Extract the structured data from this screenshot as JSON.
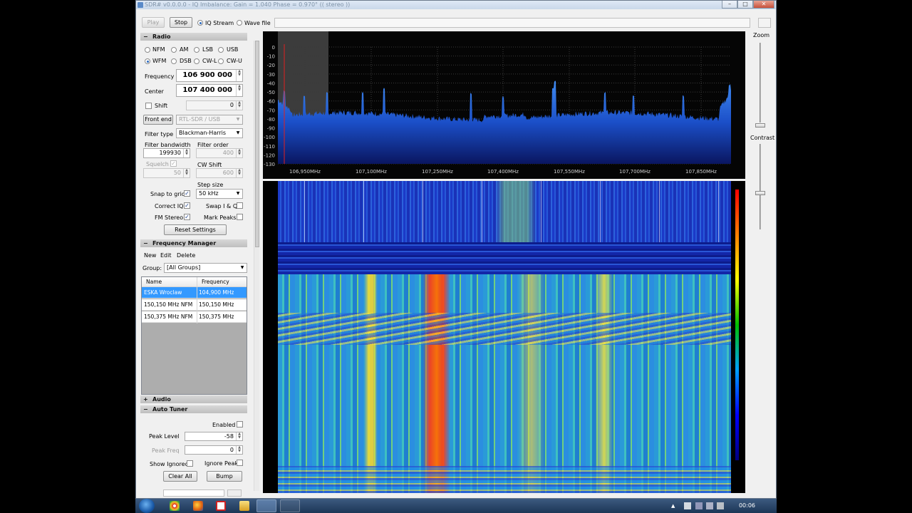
{
  "window": {
    "title": "SDR# v0.0.0.0 - IQ Imbalance: Gain = 1.040 Phase = 0.970° (( stereo ))"
  },
  "overlay_counter": "19",
  "toolbar": {
    "play": "Play",
    "stop": "Stop",
    "iq_stream": "IQ Stream",
    "wave_file": "Wave file"
  },
  "radio": {
    "header": "Radio",
    "modes_row1": [
      "NFM",
      "AM",
      "LSB",
      "USB"
    ],
    "modes_row2": [
      "WFM",
      "DSB",
      "CW-L",
      "CW-U"
    ],
    "selected_mode": "WFM",
    "frequency_label": "Frequency",
    "frequency_value": "106 900 000",
    "center_label": "Center",
    "center_value": "107 400 000",
    "shift_label": "Shift",
    "shift_value": "0",
    "front_end_button": "Front end",
    "front_end_value": "RTL-SDR / USB",
    "filter_type_label": "Filter type",
    "filter_type_value": "Blackman-Harris",
    "filter_bandwidth_label": "Filter bandwidth",
    "filter_bandwidth_value": "199930",
    "filter_order_label": "Filter order",
    "filter_order_value": "400",
    "squelch_label": "Squelch",
    "squelch_value": "50",
    "cw_shift_label": "CW Shift",
    "cw_shift_value": "600",
    "step_size_label": "Step size",
    "step_size_value": "50 kHz",
    "snap_to_grid_label": "Snap to grid",
    "swap_iq_label": "Swap I & Q",
    "correct_iq_label": "Correct IQ",
    "mark_peaks_label": "Mark Peaks",
    "fm_stereo_label": "FM Stereo",
    "reset_settings": "Reset Settings"
  },
  "freq_manager": {
    "header": "Frequency Manager",
    "menu": [
      "New",
      "Edit",
      "Delete"
    ],
    "group_label": "Group:",
    "group_value": "[All Groups]",
    "columns": [
      "Name",
      "Frequency"
    ],
    "rows": [
      {
        "name": "ESKA Wroclaw",
        "freq": "104,900 MHz"
      },
      {
        "name": "150,150 MHz NFM",
        "freq": "150,150 MHz"
      },
      {
        "name": "150,375 MHz NFM",
        "freq": "150,375 MHz"
      }
    ]
  },
  "audio": {
    "header": "Audio"
  },
  "auto_tuner": {
    "header": "Auto Tuner",
    "enabled_label": "Enabled",
    "peak_level_label": "Peak Level",
    "peak_level_value": "-58",
    "peak_freq_label": "Peak Freq",
    "peak_freq_value": "0",
    "show_ignored_label": "Show Ignored",
    "ignore_peak_label": "Ignore Peak",
    "clear_all": "Clear All",
    "bump": "Bump"
  },
  "spectrum": {
    "y_ticks": [
      "0",
      "-10",
      "-20",
      "-30",
      "-40",
      "-50",
      "-60",
      "-70",
      "-80",
      "-90",
      "-100",
      "-110",
      "-120",
      "-130"
    ],
    "x_ticks": [
      "106,950MHz",
      "107,100MHz",
      "107,250MHz",
      "107,400MHz",
      "107,550MHz",
      "107,700MHz",
      "107,850MHz"
    ]
  },
  "right_panel": {
    "zoom_label": "Zoom",
    "contrast_label": "Contrast"
  },
  "taskbar": {
    "clock": "00:06"
  }
}
